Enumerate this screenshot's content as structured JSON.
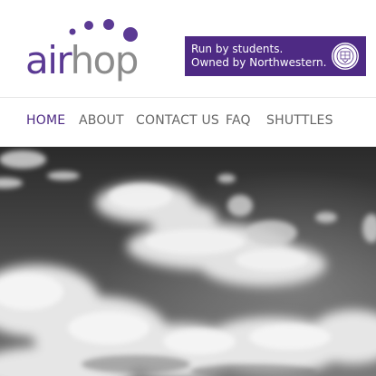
{
  "logo": {
    "part1": "air",
    "part2": "hop",
    "color_primary": "#5b3a94",
    "color_secondary": "#8c8c8c"
  },
  "promo": {
    "line1": "Run by students.",
    "line2": "Owned by Northwestern.",
    "background": "#4e2a84",
    "icon": "northwestern-seal-icon"
  },
  "nav": {
    "items": [
      {
        "label": "HOME",
        "active": true
      },
      {
        "label": "ABOUT",
        "active": false
      },
      {
        "label": "CONTACT US",
        "active": false
      },
      {
        "label": "FAQ",
        "active": false
      },
      {
        "label": "SHUTTLES",
        "active": false
      }
    ],
    "active_color": "#4e2a84",
    "inactive_color": "#666666"
  },
  "hero": {
    "subject": "clouds-photo",
    "style": "grayscale"
  }
}
